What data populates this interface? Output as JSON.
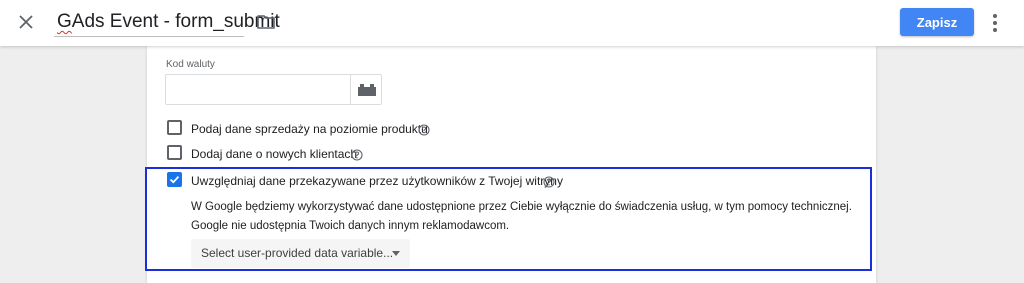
{
  "topbar": {
    "title_part1": "G",
    "title_part2": "Ads Event - form_submit",
    "save_label": "Zapisz",
    "icons": {
      "close": "close-icon",
      "folder": "folder-icon",
      "more": "more-vert-icon"
    }
  },
  "form": {
    "currency": {
      "label": "Kod waluty",
      "value": "",
      "variable_icon": "variable-brick-icon"
    },
    "options": [
      {
        "label": "Podaj dane sprzedaży na poziomie produktu",
        "checked": false
      },
      {
        "label": "Dodaj dane o nowych klientach",
        "checked": false
      },
      {
        "label": "Uwzględniaj dane przekazywane przez użytkowników z Twojej witryny",
        "checked": true
      }
    ],
    "user_data": {
      "description_line1": "W Google będziemy wykorzystywać dane udostępnione przez Ciebie wyłącznie do świadczenia usług, w tym pomocy technicznej.",
      "description_line2": "Google nie udostępnia Twoich danych innym reklamodawcom.",
      "select_placeholder": "Select user-provided data variable..."
    }
  },
  "colors": {
    "primary": "#4285f4",
    "checkbox_checked": "#1a73e8",
    "highlight_border": "#1a2fdc"
  }
}
